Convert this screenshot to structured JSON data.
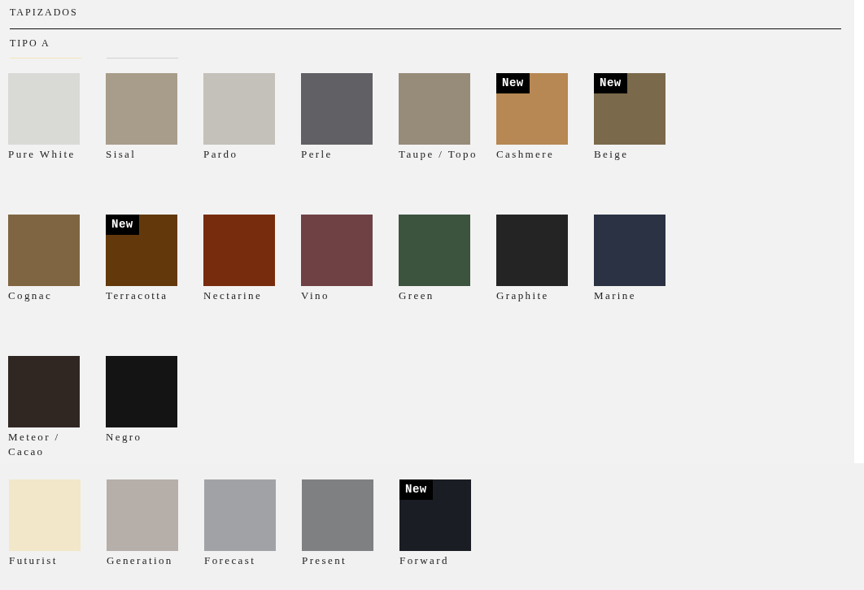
{
  "section_title": "TAPIZADOS",
  "subsection_title": "TIPO A",
  "indicators": [
    {
      "selected": true
    },
    {
      "selected": false
    }
  ],
  "groups": [
    {
      "swatches": [
        {
          "name": "Pure White",
          "color": "#d9d9d6"
        },
        {
          "name": "Sisal",
          "color": "#a89c8a"
        },
        {
          "name": "Pardo",
          "color": "#c3c1b9"
        },
        {
          "name": "Perle",
          "color": "#606065"
        },
        {
          "name": "Taupe / Topo",
          "color": "#978b7a"
        },
        {
          "name": "Cashmere",
          "color": "#b78853",
          "badge": "New"
        },
        {
          "name": "Beige",
          "color": "#7b694b",
          "badge": "New"
        },
        {
          "name": "Cognac",
          "color": "#7f6542"
        },
        {
          "name": "Terracotta",
          "color": "#63380b",
          "badge": "New"
        },
        {
          "name": "Nectarine",
          "color": "#782c0e"
        },
        {
          "name": "Vino",
          "color": "#6f4144"
        },
        {
          "name": "Green",
          "color": "#3c533e"
        },
        {
          "name": "Graphite",
          "color": "#242424"
        },
        {
          "name": "Marine",
          "color": "#2a3244"
        },
        {
          "name": "Meteor / Cacao",
          "color": "#302723"
        },
        {
          "name": "Negro",
          "color": "#141414"
        }
      ]
    },
    {
      "swatches": [
        {
          "name": "Futurist",
          "color": "#f3e7c9"
        },
        {
          "name": "Generation",
          "color": "#b6aea8"
        },
        {
          "name": "Forecast",
          "color": "#a1a2a6"
        },
        {
          "name": "Present",
          "color": "#7f8082"
        },
        {
          "name": "Forward",
          "color": "#1b1d24",
          "badge": "New"
        }
      ]
    }
  ]
}
